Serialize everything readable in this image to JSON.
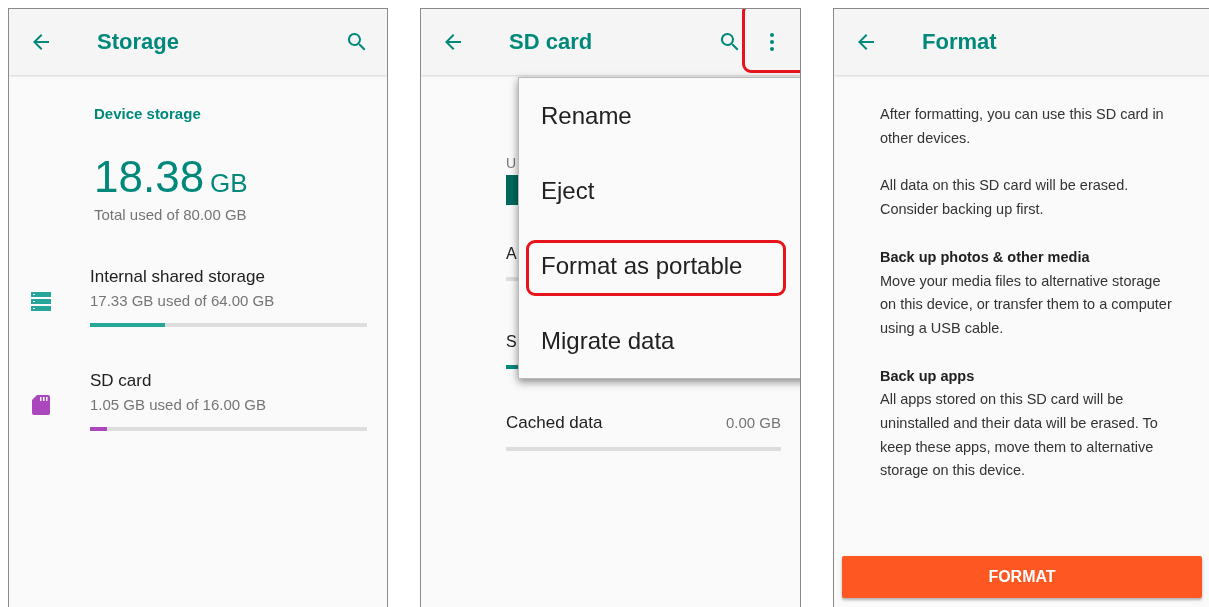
{
  "storage_screen": {
    "title": "Storage",
    "section_label": "Device storage",
    "used_amount": "18.38",
    "used_unit": "GB",
    "total_caption": "Total used of 80.00 GB",
    "volumes": [
      {
        "kind": "internal",
        "name": "Internal shared storage",
        "usage": "17.33 GB used of 64.00 GB",
        "level": 0.27,
        "color": "#26a69a"
      },
      {
        "kind": "sdcard",
        "name": "SD card",
        "usage": "1.05 GB used of 16.00 GB",
        "level": 0.06,
        "color": "#ab47bc"
      }
    ]
  },
  "sd_card_screen": {
    "title": "SD card",
    "more_button_highlighted": true,
    "partial_caption": "U",
    "partial_rows": [
      {
        "label": "A"
      },
      {
        "label": "S",
        "level": 0.05
      }
    ],
    "cached_row": {
      "label": "Cached data",
      "value": "0.00 GB",
      "level": 0
    },
    "menu": [
      {
        "label": "Rename",
        "highlighted": false
      },
      {
        "label": "Eject",
        "highlighted": false
      },
      {
        "label": "Format as portable",
        "highlighted": true
      },
      {
        "label": "Migrate data",
        "highlighted": false
      }
    ]
  },
  "format_screen": {
    "title": "Format",
    "paragraphs": [
      {
        "text": "After formatting, you can use this SD card in other devices."
      },
      {
        "text": "All data on this SD card will be erased. Consider backing up first."
      },
      {
        "heading": "Back up photos & other media",
        "text": "Move your media files to alternative storage on this device, or transfer them to a computer using a USB cable."
      },
      {
        "heading": "Back up apps",
        "text": "All apps stored on this SD card will be uninstalled and their data will be erased. To keep these apps, move them to alternative storage on this device."
      }
    ],
    "button": "FORMAT"
  }
}
